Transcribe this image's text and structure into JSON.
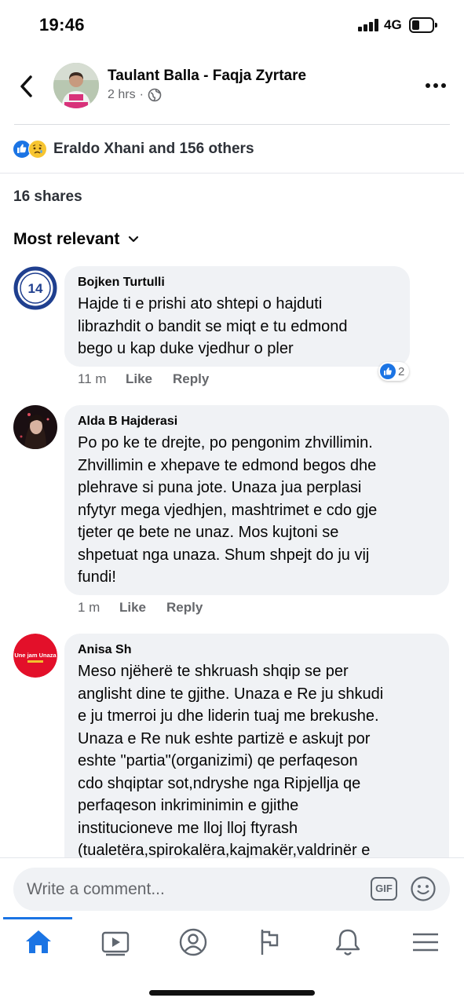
{
  "status_bar": {
    "time": "19:46",
    "network": "4G"
  },
  "post_header": {
    "page_name": "Taulant Balla - Faqja Zyrtare",
    "time_ago": "2 hrs",
    "privacy_icon": "globe-icon",
    "back_icon": "chevron-left-icon",
    "more_icon": "more-dots-icon"
  },
  "reactions": {
    "summary": "Eraldo Xhani and 156 others",
    "icons": [
      "like-reaction-icon",
      "sad-reaction-icon"
    ]
  },
  "shares": {
    "label": "16 shares"
  },
  "sort": {
    "label": "Most relevant",
    "icon": "chevron-down-icon"
  },
  "comments": [
    {
      "author": "Bojken Turtulli",
      "text": "Hajde ti e prishi ato shtepi o hajduti\nlibrazhdit o bandit se miqt e tu edmond\nbego u kap duke vjedhur o pler",
      "time": "11 m",
      "like_label": "Like",
      "reply_label": "Reply",
      "reaction_count": "2",
      "avatar_text": "14"
    },
    {
      "author": "Alda B Hajderasi",
      "text": "Po po ke te drejte, po pengonim zhvillimin.\nZhvillimin e xhepave te edmond begos dhe\nplehrave si puna jote. Unaza jua perplasi\nnfytyr  mega vjedhjen, mashtrimet e cdo gje\ntjeter qe bete ne unaz. Mos kujtoni se\nshpetuat nga unaza. Shum shpejt do ju vij\nfundi!",
      "time": "1 m",
      "like_label": "Like",
      "reply_label": "Reply"
    },
    {
      "author": "Anisa Sh",
      "text": "Meso njëherë te shkruash shqip se per\nanglisht dine te gjithe. Unaza e Re ju shkudi\ne ju tmerroi ju dhe liderin tuaj me brekushe.\nUnaza e Re nuk eshte partizë e askujt por\neshte \"partia\"(organizimi) qe perfaqeson\ncdo shqiptar sot,ndryshe nga Ripjellja qe\nperfaqeson inkriminimin e gjithe\ninstitucioneve me lloj lloj ftyrash\n(tualetëra,spirokalëra,kajmakër,valdrinër e",
      "avatar_text": "Une jam Unaza"
    }
  ],
  "composer": {
    "placeholder": "Write a comment...",
    "gif_label": "GIF",
    "emoji_icon": "smiley-icon"
  },
  "tabbar": {
    "items": [
      {
        "name": "home",
        "icon": "home-icon",
        "active": true
      },
      {
        "name": "watch",
        "icon": "video-play-icon"
      },
      {
        "name": "profile",
        "icon": "profile-icon"
      },
      {
        "name": "pages",
        "icon": "flag-icon"
      },
      {
        "name": "notifications",
        "icon": "bell-icon"
      },
      {
        "name": "menu",
        "icon": "hamburger-menu-icon"
      }
    ]
  },
  "colors": {
    "accent": "#1b74e4",
    "bubble": "#f0f2f5",
    "secondary_text": "#65676b"
  }
}
